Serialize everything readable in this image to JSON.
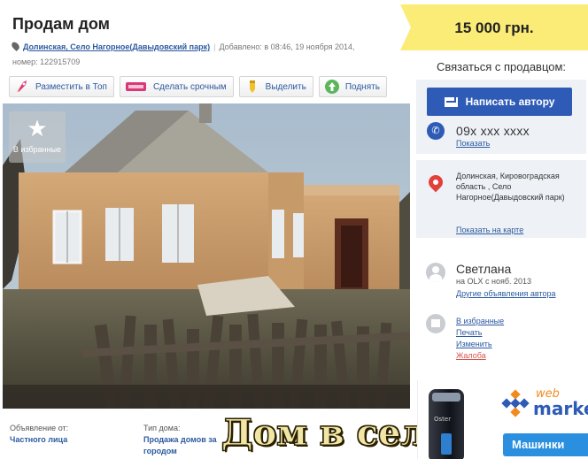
{
  "listing": {
    "title": "Продам дом",
    "location": "Долинская, Село Нагорное(Давыдовский парк)",
    "added": "Добавлено: в 08:46, 19 ноября 2014,",
    "number": "номер: 122915709"
  },
  "actions": [
    {
      "label": "Разместить в Топ",
      "icon": "rocket-icon"
    },
    {
      "label": "Сделать срочным",
      "icon": "urgent-badge-icon"
    },
    {
      "label": "Выделить",
      "icon": "marker-icon"
    },
    {
      "label": "Поднять",
      "icon": "raise-icon"
    }
  ],
  "photo": {
    "fav_label": "В избранные",
    "fav_icon": "star-icon",
    "overlay_text": "Дом в селе"
  },
  "details": {
    "owner_label": "Объявление от:",
    "owner_value": "Частного лица",
    "type_label": "Тип дома:",
    "type_value": "Продажа домов за городом"
  },
  "price": "15 000 грн.",
  "contact": {
    "heading": "Связаться с продавцом:",
    "write_button": "Написать автору",
    "phone": "09x xxx xxxx",
    "show_phone": "Показать",
    "address": "Долинская, Кировоградская область , Село Нагорное(Давыдовский парк)",
    "map_link": "Показать на карте"
  },
  "seller": {
    "name": "Светлана",
    "since": "на OLX с нояб. 2013",
    "other_ads": "Другие объявления автора"
  },
  "menu": {
    "favorite": "В избранные",
    "print": "Печать",
    "edit": "Изменить",
    "complain": "Жалоба"
  },
  "ad": {
    "product_text": "Oster",
    "web": "web",
    "market": "market",
    "cta": "Машинки"
  },
  "colors": {
    "price_bg": "#fbeb77",
    "primary_blue": "#2e5bb5",
    "link": "#2c5aa0",
    "panel_bg": "#eef2f6",
    "warn": "#d9534f"
  }
}
